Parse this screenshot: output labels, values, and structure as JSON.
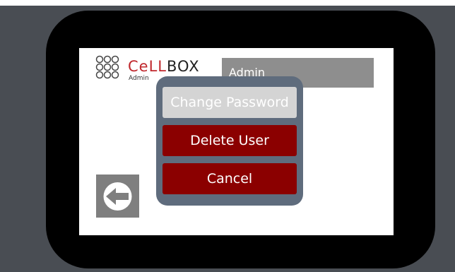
{
  "colors": {
    "background": "#494d53",
    "bezel": "#000000",
    "screen": "#ffffff",
    "user_field": "#8e8e8e",
    "dialog": "#5f6c7d",
    "button_disabled": "#d4d4d4",
    "button_danger": "#8b0000",
    "back_button": "#7f7f7f",
    "brand_red": "#c0282d"
  },
  "logo": {
    "text_red": "CeLL",
    "text_dark": "BOX",
    "subtitle": "Admin",
    "icon": "dot-grid-icon"
  },
  "user_field": {
    "value": "Admin"
  },
  "back_button": {
    "icon": "back-arrow-icon"
  },
  "dialog": {
    "buttons": [
      {
        "label": "Change Password",
        "state": "disabled"
      },
      {
        "label": "Delete User",
        "state": "enabled"
      },
      {
        "label": "Cancel",
        "state": "enabled"
      }
    ]
  }
}
